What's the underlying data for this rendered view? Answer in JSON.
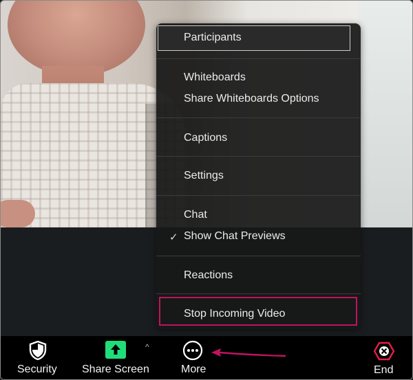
{
  "menu": {
    "items": [
      {
        "label": "Participants",
        "highlighted": true
      },
      {
        "label": "Whiteboards"
      },
      {
        "label": "Share Whiteboards Options"
      },
      {
        "label": "Captions"
      },
      {
        "label": "Settings"
      },
      {
        "label": "Chat"
      },
      {
        "label": "Show Chat Previews",
        "checked": true,
        "check_mark": "✓"
      },
      {
        "label": "Reactions"
      },
      {
        "label": "Stop Incoming Video",
        "annotated": true
      }
    ]
  },
  "toolbar": {
    "security_label": "Security",
    "share_label": "Share Screen",
    "more_label": "More",
    "end_label": "End"
  },
  "colors": {
    "share_green": "#1fde7a",
    "annotation_pink": "#c0145f",
    "end_red": "#e11d48"
  },
  "icons": {
    "security": "shield-icon",
    "share": "share-arrow-up-icon",
    "more": "ellipsis-circle-icon",
    "end": "close-hexagon-icon",
    "caret": "chevron-up-icon"
  }
}
